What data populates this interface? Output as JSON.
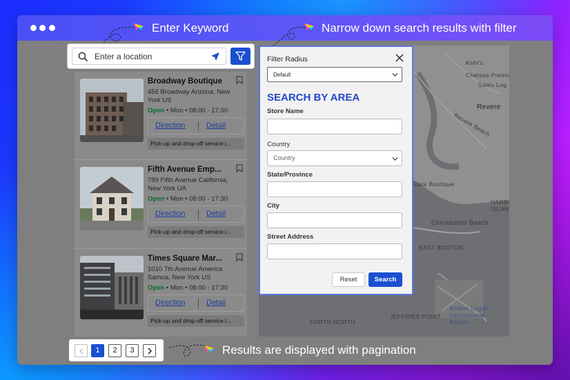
{
  "annotations": {
    "keyword": "Enter Keyword",
    "filter": "Narrow down search results with filter",
    "pagination": "Results are displayed with pagination"
  },
  "search": {
    "placeholder": "Enter a location"
  },
  "stores": [
    {
      "name": "Broadway Boutique",
      "address": "456 Broadway Arizona, New York US",
      "status": "Open",
      "day": "Mon",
      "hours": "08:00 - 17:30",
      "direction_label": "Direction",
      "detail_label": "Detail",
      "service": "Pick-up and drop-off service i..."
    },
    {
      "name": "Fifth Avenue Emp...",
      "address": "789 Fifth Avenue California, New York UA",
      "status": "Open",
      "day": "Mon",
      "hours": "08:00 - 17:30",
      "direction_label": "Direction",
      "detail_label": "Detail",
      "service": "Pick-up and drop-off service i..."
    },
    {
      "name": "Times Square Mar...",
      "address": "1010 7th Avenue America Samoa, New York US",
      "status": "Open",
      "day": "Mon",
      "hours": "08:00 - 17:30",
      "direction_label": "Direction",
      "detail_label": "Detail",
      "service": "Pick-up and drop-off service i..."
    }
  ],
  "filter": {
    "radius_label": "Filter Radius",
    "radius_value": "Default",
    "section_title": "SEARCH BY AREA",
    "store_name_label": "Store Name",
    "country_label": "Country",
    "country_placeholder": "Country",
    "state_label": "State/Province",
    "city_label": "City",
    "street_label": "Street Address",
    "reset_label": "Reset",
    "search_label": "Search"
  },
  "pagination": {
    "pages": [
      "1",
      "2",
      "3"
    ],
    "current": "1"
  },
  "map_labels": {
    "revere": "Revere",
    "east_boston": "EAST BOSTON",
    "fourth_north": "FORTH NORTH",
    "logan": "Boston Logan International Airport",
    "jeffries": "JEFFRIES POINT",
    "constitution": "Constitution Beach",
    "state_boutique": "State Boutique",
    "harbor": "HARBOR ISLAND",
    "revere_beach": "Revere Beach",
    "kohls": "Kohl's",
    "sales": "Sales Log",
    "chelsea": "Chelsea Premium"
  },
  "colors": {
    "accent": "#1b4fd1",
    "open": "#0b6b2c",
    "section_title": "#2447c9"
  }
}
